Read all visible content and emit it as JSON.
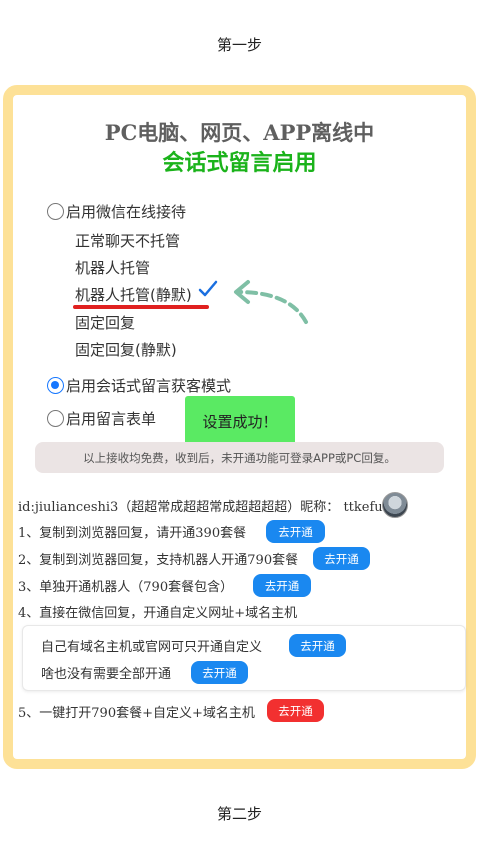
{
  "steps": {
    "first": "第一步",
    "second": "第二步"
  },
  "card": {
    "title_line1": "PC电脑、网页、APP离线中",
    "title_line2": "会话式留言启用",
    "colors": {
      "border": "#fde197",
      "title2": "#1bb31b",
      "radio_checked": "#1677ff",
      "underline": "#e0201f"
    },
    "options": [
      {
        "label": "启用微信在线接待",
        "checked": false
      },
      {
        "label": "启用会话式留言获客模式",
        "checked": true
      },
      {
        "label": "启用留言表单",
        "checked": false
      }
    ],
    "sub_options": [
      "正常聊天不托管",
      "机器人托管",
      "机器人托管(静默)",
      "固定回复",
      "固定回复(静默)"
    ],
    "highlighted_sub_option": "机器人托管(静默)",
    "toast": "设置成功！",
    "notice": "以上接收均免费，收到后，未开通功能可登录APP或PC回复。"
  },
  "account": {
    "id_line": "id:jiulianceshi3（超超常成超超常成超超超超）昵称： ttkefu",
    "avatar_icon": "user-avatar"
  },
  "plans": [
    {
      "text": "1、复制到浏览器回复，请开通390套餐",
      "button": "去开通",
      "button_color": "#1a88f0"
    },
    {
      "text": "2、复制到浏览器回复，支持机器人开通790套餐",
      "button": "去开通",
      "button_color": "#1a88f0"
    },
    {
      "text": "3、单独开通机器人（790套餐包含）",
      "button": "去开通",
      "button_color": "#1a88f0"
    },
    {
      "text": "4、直接在微信回复，开通自定义网址+域名主机",
      "button": null
    }
  ],
  "sub_plans": [
    {
      "text": "自己有域名主机或官网可只开通自定义",
      "button": "去开通"
    },
    {
      "text": "啥也没有需要全部开通",
      "button": "去开通"
    }
  ],
  "final_plan": {
    "text": "5、一键打开790套餐+自定义+域名主机",
    "button": "去开通",
    "button_color": "#f23030"
  }
}
